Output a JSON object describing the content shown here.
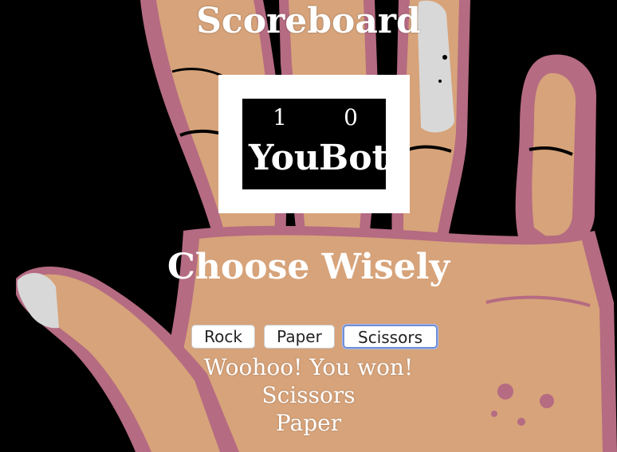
{
  "page": {
    "title": "Scoreboard",
    "choose_heading": "Choose Wisely"
  },
  "scoreboard": {
    "player": {
      "score": "1",
      "label": "You"
    },
    "bot": {
      "score": "0",
      "label": "Bot"
    }
  },
  "choices": {
    "rock_label": "Rock",
    "paper_label": "Paper",
    "scissors_label": "Scissors",
    "focused": "Scissors"
  },
  "result": {
    "message": "Woohoo! You won!",
    "player_choice": "Scissors",
    "bot_choice": "Paper"
  },
  "background": {
    "image": "hand-illustration",
    "colors": {
      "backdrop": "#000000",
      "skin": "#d7a37a",
      "shadow": "#b56b82",
      "nail": "#d8d8d8"
    }
  },
  "colors": {
    "text": "#ffffff",
    "scoreboard_frame": "#ffffff",
    "scoreboard_inner": "#000000",
    "focus_ring": "#6f8fd6"
  }
}
